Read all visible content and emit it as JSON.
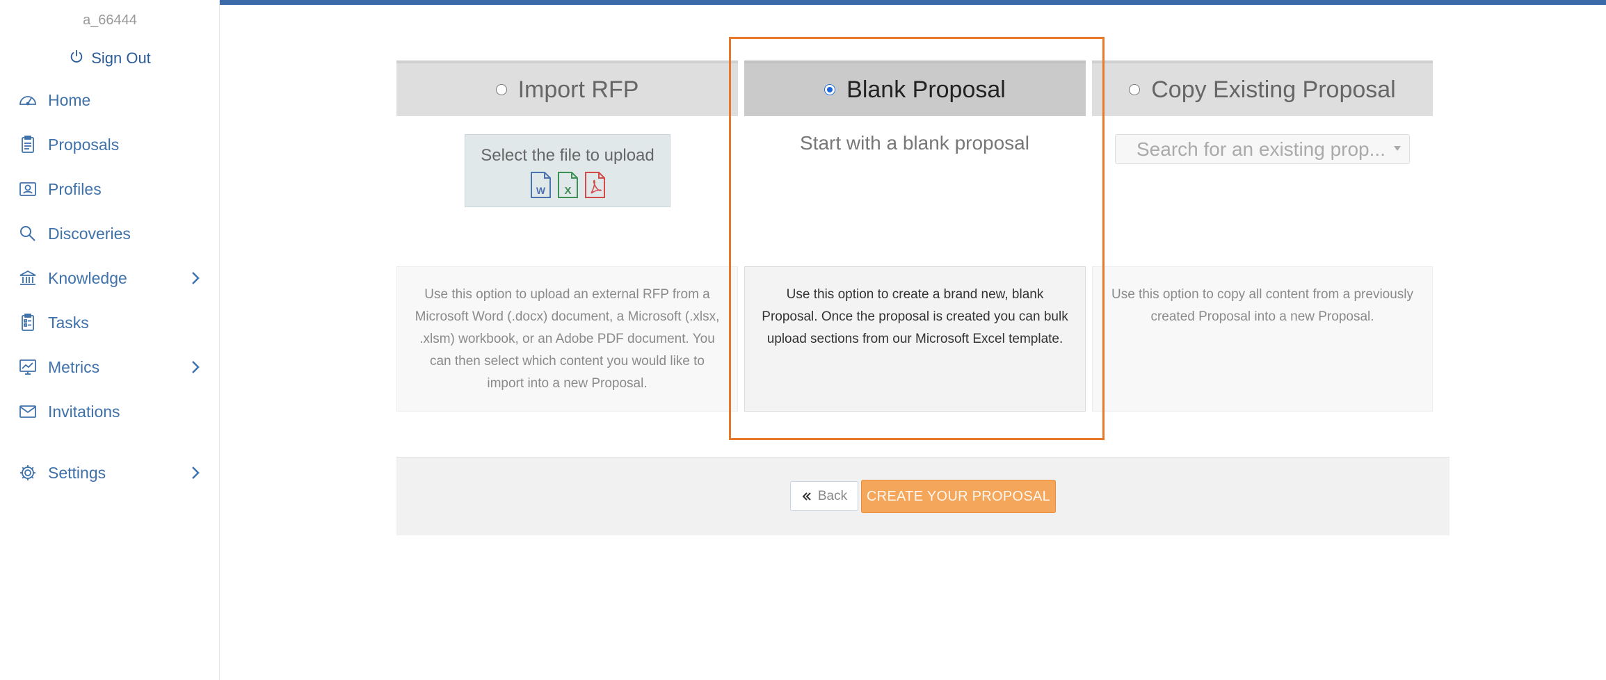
{
  "sidebar": {
    "username": "a_66444",
    "sign_out": "Sign Out",
    "items": [
      {
        "label": "Home",
        "icon": "dashboard-gauge-icon"
      },
      {
        "label": "Proposals",
        "icon": "clipboard-icon"
      },
      {
        "label": "Profiles",
        "icon": "profile-card-icon"
      },
      {
        "label": "Discoveries",
        "icon": "magnifier-icon"
      },
      {
        "label": "Knowledge",
        "icon": "bank-building-icon",
        "has_submenu": true
      },
      {
        "label": "Tasks",
        "icon": "task-list-icon"
      },
      {
        "label": "Metrics",
        "icon": "chart-monitor-icon",
        "has_submenu": true
      },
      {
        "label": "Invitations",
        "icon": "envelope-icon"
      },
      {
        "label": "Settings",
        "icon": "gear-icon",
        "has_submenu": true
      }
    ]
  },
  "options": [
    {
      "label": "Import RFP",
      "selected": false,
      "upload_label": "Select the file to upload",
      "description": "Use this option to upload an external RFP from a Microsoft Word (.docx) document, a Microsoft (.xlsx, .xlsm) workbook, or an Adobe PDF document. You can then select which content you would like to import into a new Proposal."
    },
    {
      "label": "Blank Proposal",
      "selected": true,
      "subtitle": "Start with a blank proposal",
      "description": "Use this option to create a brand new, blank Proposal. Once the proposal is created you can bulk upload sections from our Microsoft Excel template."
    },
    {
      "label": "Copy Existing Proposal",
      "selected": false,
      "search_placeholder": "Search for an existing prop...",
      "description": "Use this option to copy all content from a previously created Proposal into a new Proposal."
    }
  ],
  "footer": {
    "back": "Back",
    "create": "CREATE YOUR PROPOSAL"
  },
  "colors": {
    "accent_blue": "#3d69a8",
    "nav_text": "#3f71aa",
    "create_button": "#f4a65a",
    "highlight_border": "#e8782a"
  }
}
